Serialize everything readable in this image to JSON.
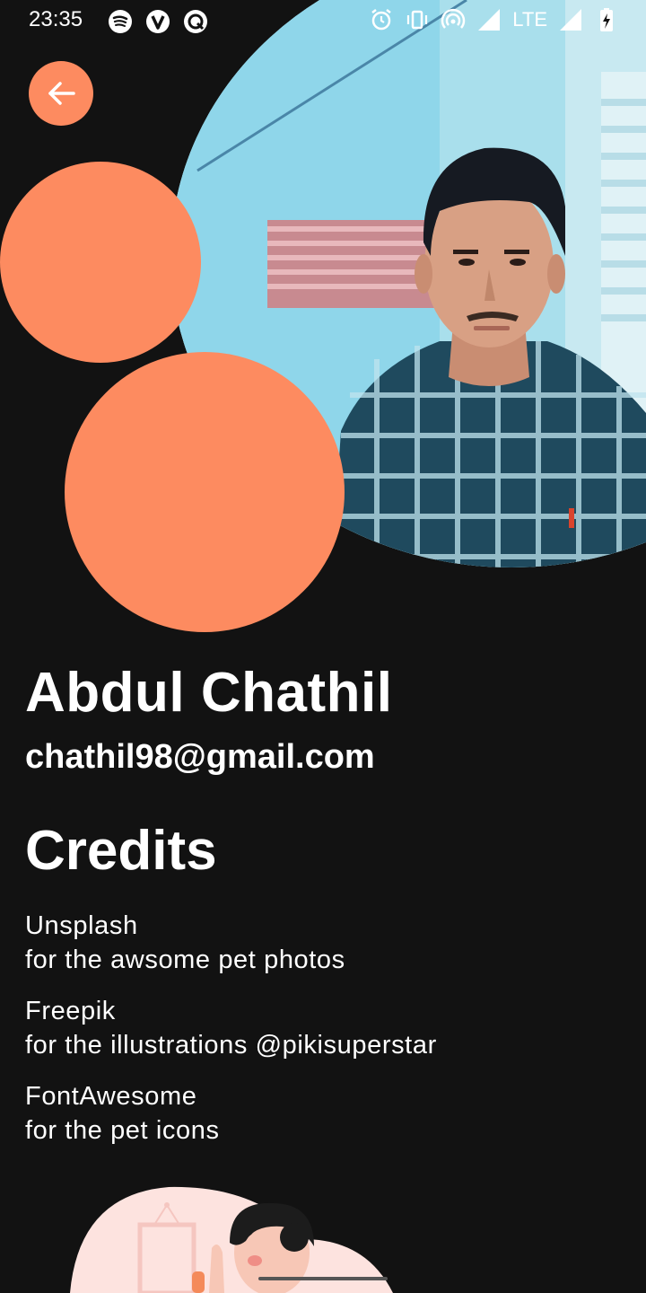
{
  "status_bar": {
    "time": "23:35",
    "network": "LTE",
    "left_icons": [
      "spotify-icon",
      "v-app-icon",
      "q-app-icon"
    ],
    "right_icons": [
      "alarm-icon",
      "vibrate-icon",
      "hotspot-icon",
      "signal-icon",
      "battery-charging-icon"
    ]
  },
  "colors": {
    "accent": "#fd8b60",
    "background": "#121212",
    "text": "#ffffff"
  },
  "profile": {
    "name": "Abdul Chathil",
    "email": "chathil98@gmail.com"
  },
  "credits": {
    "title": "Credits",
    "items": [
      {
        "source": "Unsplash",
        "description": "for the awsome pet photos"
      },
      {
        "source": "Freepik",
        "description": "for the illustrations @pikisuperstar"
      },
      {
        "source": "FontAwesome",
        "description": "for the pet icons"
      }
    ]
  }
}
